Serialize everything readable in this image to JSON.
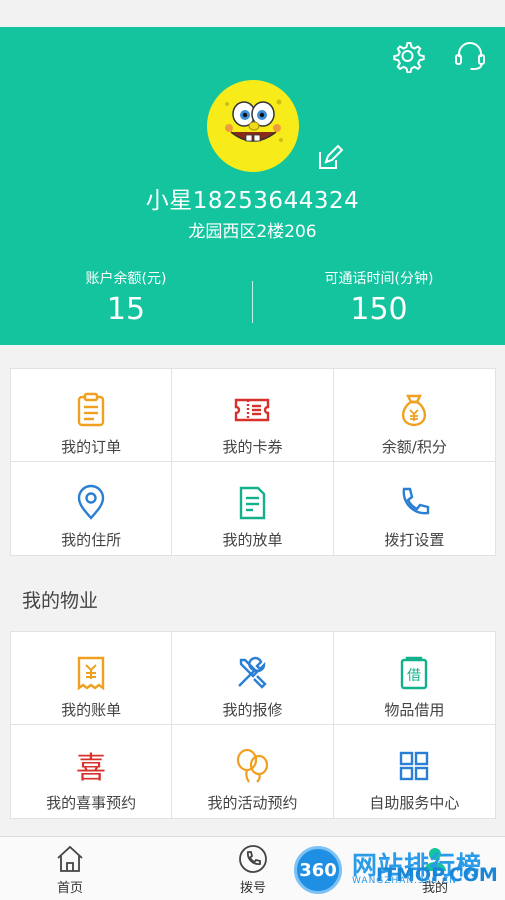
{
  "header": {
    "user_name": "小星18253644324",
    "address": "龙园西区2楼206",
    "balance_label": "账户余额(元)",
    "balance_value": "15",
    "talktime_label": "可通话时间(分钟)",
    "talktime_value": "150",
    "accent_color": "#13c49e"
  },
  "menu": [
    {
      "label": "我的订单",
      "icon": "clipboard-icon"
    },
    {
      "label": "我的卡券",
      "icon": "ticket-icon"
    },
    {
      "label": "余额/积分",
      "icon": "money-bag-icon"
    },
    {
      "label": "我的住所",
      "icon": "location-pin-icon"
    },
    {
      "label": "我的放单",
      "icon": "document-edit-icon"
    },
    {
      "label": "拨打设置",
      "icon": "phone-icon"
    }
  ],
  "property": {
    "title": "我的物业",
    "items": [
      {
        "label": "我的账单",
        "icon": "bill-icon"
      },
      {
        "label": "我的报修",
        "icon": "tools-icon"
      },
      {
        "label": "物品借用",
        "icon": "borrow-icon"
      },
      {
        "label": "我的喜事预约",
        "icon": "double-happiness-icon",
        "glyph": "喜"
      },
      {
        "label": "我的活动预约",
        "icon": "balloons-icon"
      },
      {
        "label": "自助服务中心",
        "icon": "grid-apps-icon"
      }
    ]
  },
  "tabbar": {
    "home": "首页",
    "dial": "拨号",
    "mine": "我的"
  },
  "watermark": {
    "badge": "360",
    "text": "网站排行榜",
    "brand": "ITMOP.COM",
    "sub": "WANGZHAN.360.CN"
  }
}
